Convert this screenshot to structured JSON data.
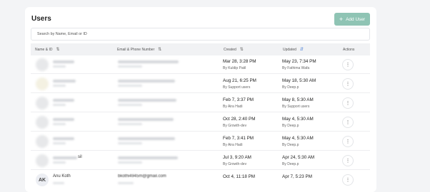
{
  "page": {
    "title": "Users",
    "add_button_label": "Add User",
    "search_placeholder": "Search by Name, Email or ID"
  },
  "table": {
    "columns": [
      "Name & ID",
      "Email & Phone Number",
      "Created",
      "Updated",
      "Actions"
    ],
    "rows": [
      {
        "created": "Mar 28, 3:28 PM",
        "created_by": "By Kuldip Patil",
        "updated": "May 23, 7:34 PM",
        "updated_by": "By Fathima Wafa"
      },
      {
        "created": "Aug 21, 6:25 PM",
        "created_by": "By Support users",
        "updated": "May 18, 5:30 AM",
        "updated_by": "By Deep.p"
      },
      {
        "created": "Feb 7, 3:37 PM",
        "created_by": "By Aira Hadi",
        "updated": "May 8, 5:30 AM",
        "updated_by": "By Support users"
      },
      {
        "created": "Oct 28, 2:40 PM",
        "created_by": "By Growth-dev",
        "updated": "May 4, 5:30 AM",
        "updated_by": "By Deep.p"
      },
      {
        "created": "Feb 7, 3:41 PM",
        "created_by": "By Aira Hadi",
        "updated": "May 4, 5:30 AM",
        "updated_by": "By Deep.p"
      },
      {
        "name_fragment": "sil",
        "created": "Jul 3, 9:20 AM",
        "created_by": "By Growth-dev",
        "updated": "Apr 24, 5:30 AM",
        "updated_by": "By Deep.p"
      },
      {
        "avatar_initials": "AK",
        "name": "Anu Koth",
        "email_fragment": "bkothi4945m@gmail.com",
        "created": "Oct 4, 11:18 PM",
        "updated": "Apr 7, 5:23 PM"
      }
    ]
  },
  "actions_symbol": "⋮",
  "colors": {
    "accent": "#8fc4b4",
    "sort_active": "#4a7fd6"
  },
  "icons": {
    "sort": "sort-icon",
    "plus": "plus-icon",
    "menu": "kebab-menu-icon"
  }
}
